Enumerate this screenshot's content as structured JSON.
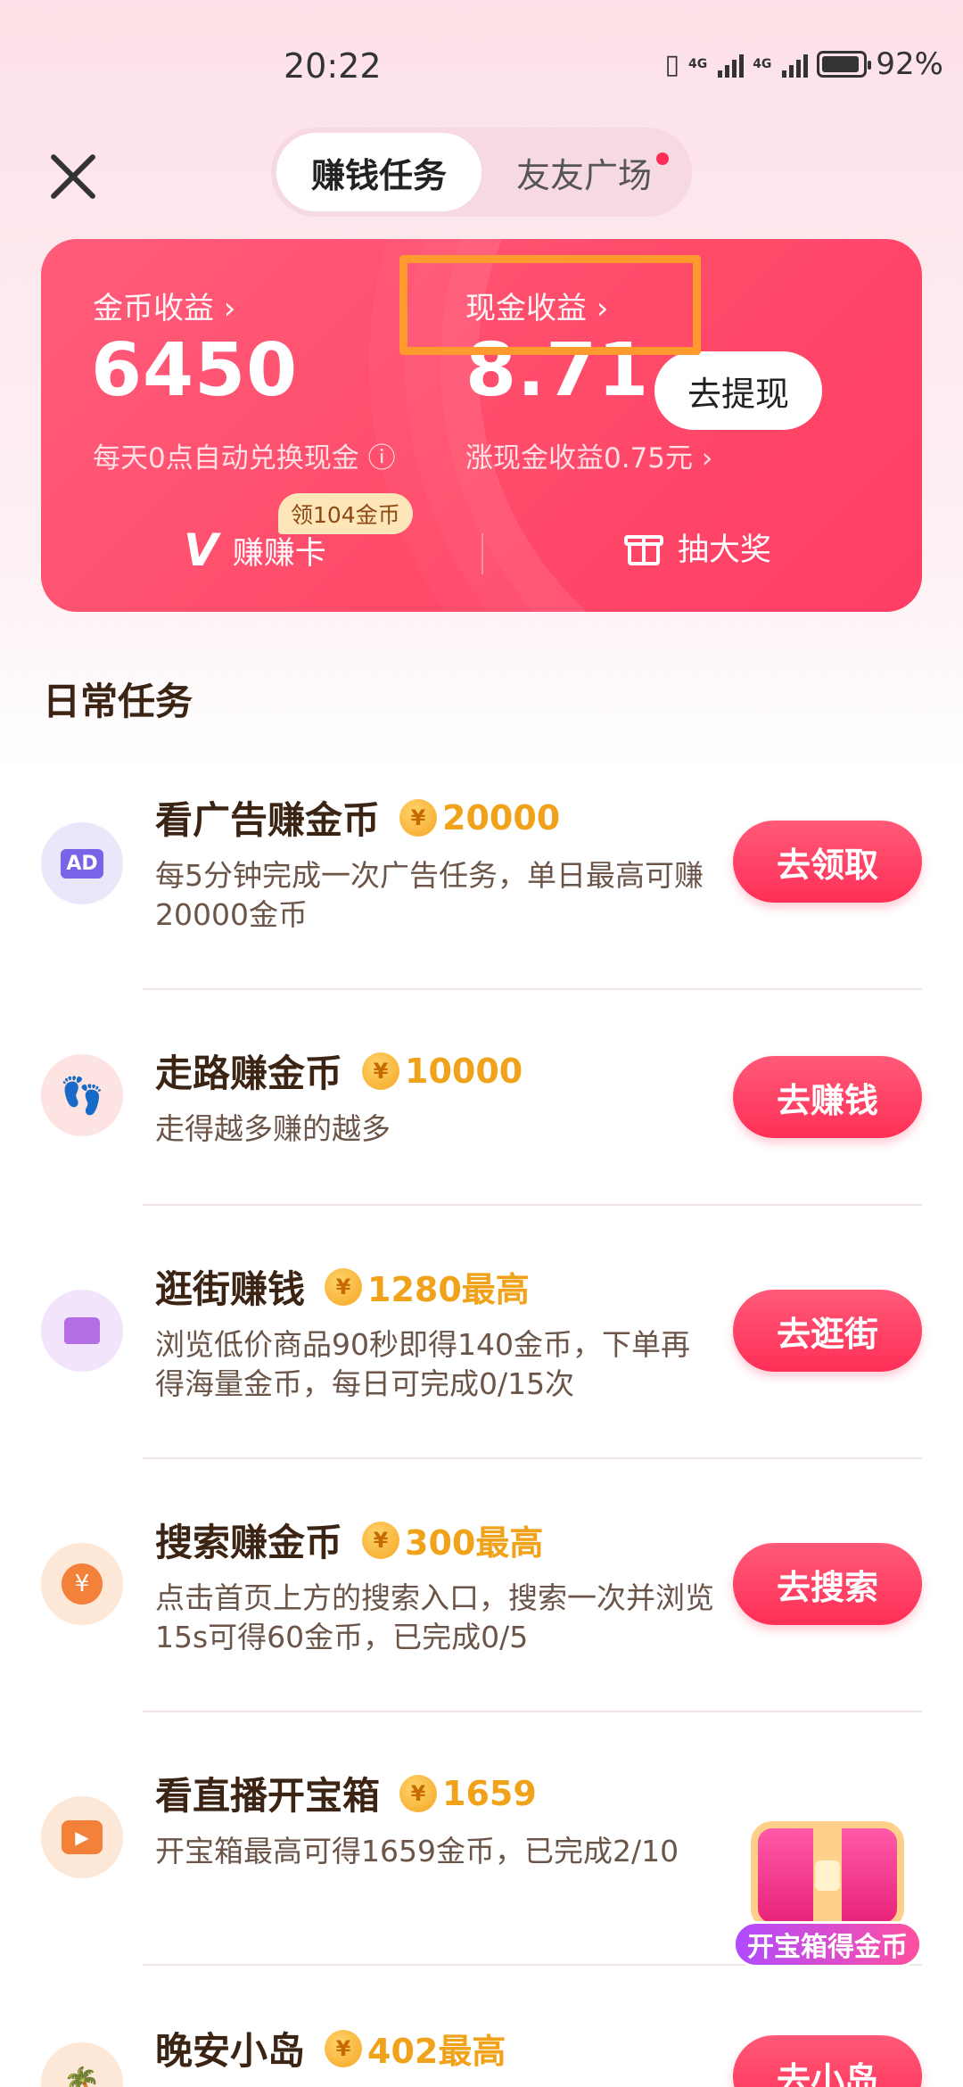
{
  "status_bar": {
    "time": "20:22",
    "battery": "92%",
    "net1": "4G",
    "net2": "4G",
    "battery_level": 0.92
  },
  "tabs": [
    {
      "label": "赚钱任务",
      "active": true
    },
    {
      "label": "友友广场",
      "active": false
    }
  ],
  "earnings_card": {
    "coin_label": "金币收益 ›",
    "coin_value": "6450",
    "coin_sub": "每天0点自动兑换现金 ⓘ",
    "cash_label": "现金收益 ›",
    "cash_value": "8.71",
    "cash_sub": "涨现金收益0.75元 ›",
    "withdraw_label": "去提现",
    "badge": "领104金币",
    "card_label": "赚赚卡",
    "prize_label": "抽大奖"
  },
  "section_title": "日常任务",
  "tasks": [
    {
      "title": "看广告赚金币",
      "reward": "20000",
      "desc": "每5分钟完成一次广告任务，单日最高可赚20000金币",
      "button": "去领取",
      "icon": "ad-icon",
      "icon_text": "AD"
    },
    {
      "title": "走路赚金币",
      "reward": "10000",
      "desc": "走得越多赚的越多",
      "button": "去赚钱",
      "icon": "footprints-icon",
      "icon_text": "👣"
    },
    {
      "title": "逛街赚钱",
      "reward": "1280最高",
      "desc": "浏览低价商品90秒即得140金币，下单再得海量金币，每日可完成0/15次",
      "button": "去逛街",
      "icon": "shop-icon",
      "icon_text": "▬"
    },
    {
      "title": "搜索赚金币",
      "reward": "300最高",
      "desc": "点击首页上方的搜索入口，搜索一次并浏览15s可得60金币，已完成0/5",
      "button": "去搜索",
      "icon": "yuan-icon",
      "icon_text": "¥"
    },
    {
      "title": "看直播开宝箱",
      "reward": "1659",
      "desc": "开宝箱最高可得1659金币，已完成2/10",
      "button": "",
      "icon": "live-tv-icon",
      "icon_text": "▶"
    },
    {
      "title": "晚安小岛",
      "reward": "402最高",
      "desc": "",
      "button": "去小岛",
      "icon": "island-icon",
      "icon_text": "🌴"
    }
  ],
  "chest_label": "开宝箱得金币",
  "coin_symbol": "¥",
  "colors": {
    "accent": "#ff3d66",
    "reward": "#f0a21a",
    "highlight": "#ff9a2e"
  }
}
